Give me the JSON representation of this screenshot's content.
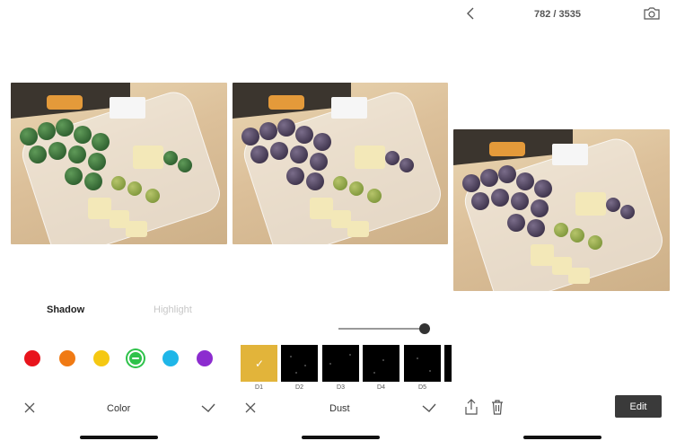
{
  "colors": {
    "accent_green": "#2ec24a",
    "dust_selected": "#e2b43a",
    "edit_button_bg": "#3a3a3a"
  },
  "color_panel": {
    "tabs": [
      {
        "label": "Shadow",
        "active": true
      },
      {
        "label": "Highlight",
        "active": false
      }
    ],
    "swatches": [
      {
        "name": "red",
        "hex": "#e8141c",
        "selected": false
      },
      {
        "name": "orange",
        "hex": "#f07a14",
        "selected": false
      },
      {
        "name": "yellow",
        "hex": "#f5c812",
        "selected": false
      },
      {
        "name": "green",
        "hex": "#2ec24a",
        "selected": true
      },
      {
        "name": "cyan",
        "hex": "#1fb6e8",
        "selected": false
      },
      {
        "name": "purple",
        "hex": "#8c2ccf",
        "selected": false
      }
    ],
    "bottom": {
      "cancel_icon": "close-icon",
      "title": "Color",
      "confirm_icon": "check-icon"
    }
  },
  "dust_panel": {
    "slider_value": 1.0,
    "presets": [
      {
        "label": "D1",
        "selected": true
      },
      {
        "label": "D2",
        "selected": false
      },
      {
        "label": "D3",
        "selected": false
      },
      {
        "label": "D4",
        "selected": false
      },
      {
        "label": "D5",
        "selected": false
      }
    ],
    "bottom": {
      "cancel_icon": "close-icon",
      "title": "Dust",
      "confirm_icon": "check-icon"
    }
  },
  "viewer": {
    "counter": "782 / 3535",
    "back_icon": "chevron-left-icon",
    "camera_icon": "camera-icon",
    "share_icon": "share-icon",
    "trash_icon": "trash-icon",
    "edit_label": "Edit"
  }
}
